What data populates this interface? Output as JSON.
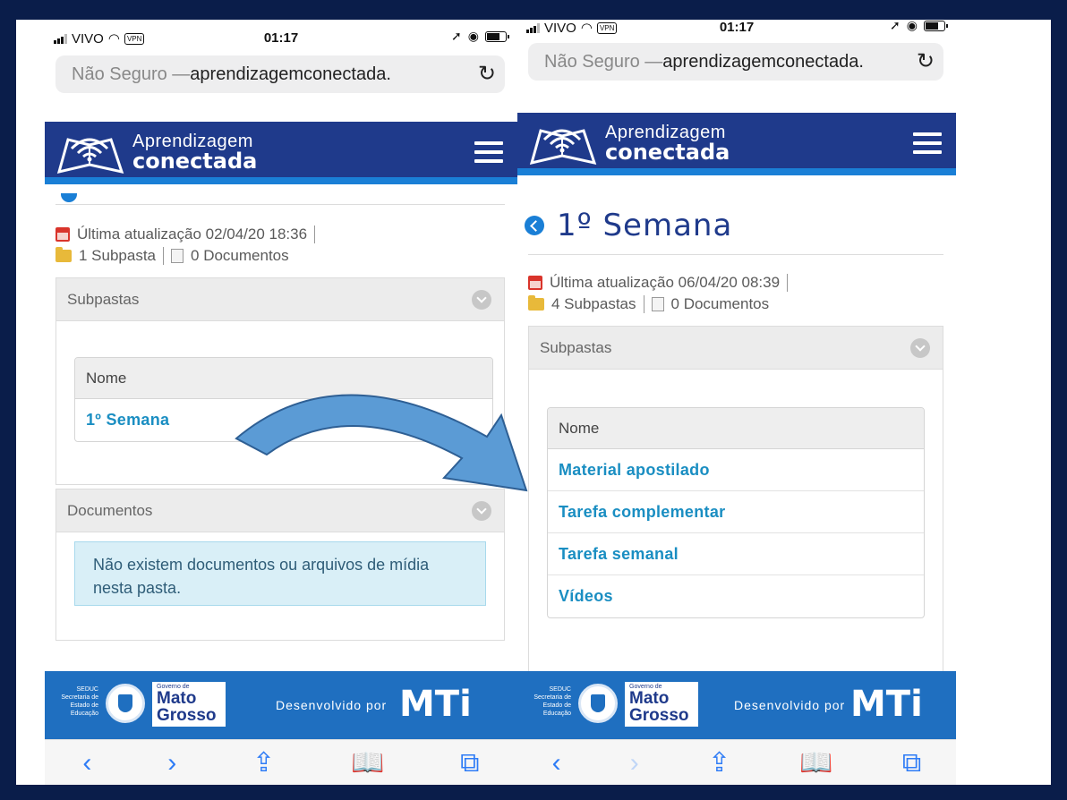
{
  "colors": {
    "page_frame": "#0a1d4a",
    "header": "#1f3a8b",
    "header_stripe": "#1a7fd6",
    "link": "#1a8ec2",
    "footer": "#1f6fc0",
    "arrow": "#5b9bd5"
  },
  "left": {
    "status": {
      "carrier": "VIVO",
      "vpn": "VPN",
      "time": "01:17"
    },
    "url": {
      "prefix": "Não Seguro — ",
      "host": "aprendizagemconectada.",
      "reload_icon": "↻"
    },
    "logo": {
      "line1": "Aprendizagem",
      "line2": "conectada"
    },
    "meta": {
      "updated": "Última atualização 02/04/20 18:36",
      "subfolders": "1 Subpasta",
      "documents": "0 Documentos"
    },
    "subpastas": {
      "heading": "Subpastas",
      "column": "Nome",
      "rows": [
        "1º Semana"
      ]
    },
    "documentos": {
      "heading": "Documentos",
      "alert": "Não existem documentos ou arquivos de mídia nesta pasta."
    },
    "footer": {
      "seduc": [
        "SEDUC",
        "Secretaria de",
        "Estado de",
        "Educação"
      ],
      "gov_small": "Governo de",
      "gov_big_1": "Mato",
      "gov_big_2": "Grosso",
      "dev": "Desenvolvido por",
      "mti": "MTi"
    },
    "toolbar": {
      "back": "‹",
      "forward": "›",
      "share": "⇪",
      "bookmarks": "📖",
      "tabs": "⧉"
    }
  },
  "right": {
    "status": {
      "carrier": "VIVO",
      "vpn": "VPN",
      "time": "01:17"
    },
    "url": {
      "prefix": "Não Seguro — ",
      "host": "aprendizagemconectada.",
      "reload_icon": "↻"
    },
    "logo": {
      "line1": "Aprendizagem",
      "line2": "conectada"
    },
    "title": "1º Semana",
    "meta": {
      "updated": "Última atualização 06/04/20 08:39",
      "subfolders": "4 Subpastas",
      "documents": "0 Documentos"
    },
    "subpastas": {
      "heading": "Subpastas",
      "column": "Nome",
      "rows": [
        "Material apostilado",
        "Tarefa complementar",
        "Tarefa semanal",
        "Vídeos"
      ]
    },
    "footer": {
      "seduc": [
        "SEDUC",
        "Secretaria de",
        "Estado de",
        "Educação"
      ],
      "gov_small": "Governo de",
      "gov_big_1": "Mato",
      "gov_big_2": "Grosso",
      "dev": "Desenvolvido por",
      "mti": "MTi"
    },
    "toolbar": {
      "back": "‹",
      "forward": "›",
      "share": "⇪",
      "bookmarks": "📖",
      "tabs": "⧉"
    }
  }
}
